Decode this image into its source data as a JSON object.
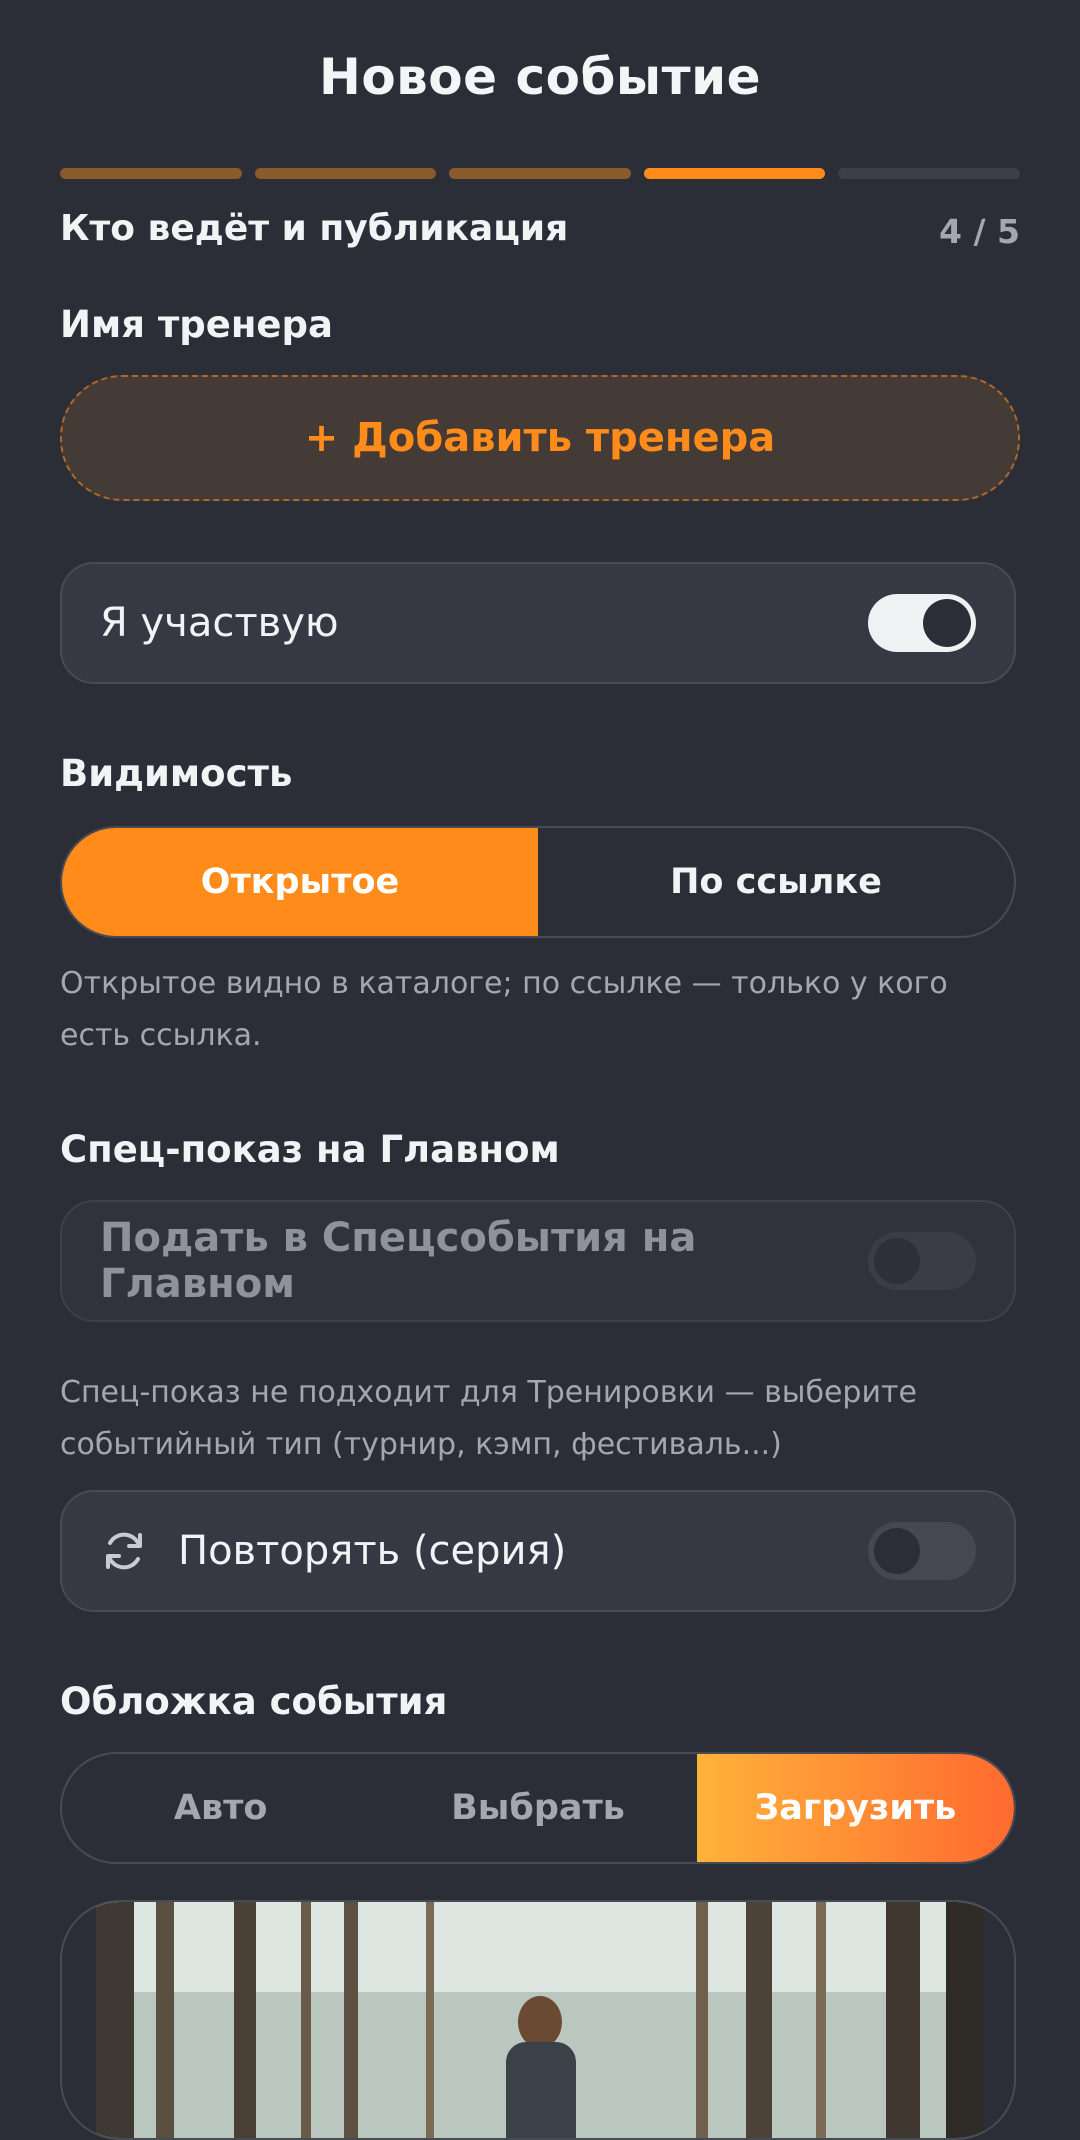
{
  "header": {
    "title": "Новое событие"
  },
  "progress": {
    "steps_total": 5,
    "current_step": 4
  },
  "step": {
    "title": "Кто ведёт и публикация",
    "counter": "4 / 5"
  },
  "coach": {
    "label": "Имя тренера",
    "add_button": "+ Добавить тренера"
  },
  "participate": {
    "label": "Я участвую",
    "enabled": true
  },
  "visibility": {
    "label": "Видимость",
    "options": [
      "Открытое",
      "По ссылке"
    ],
    "selected": "Открытое",
    "hint": "Открытое видно в каталоге; по ссылке — только у кого есть ссылка."
  },
  "special": {
    "label": "Спец-показ на Главном",
    "toggle_label": "Подать в Спецсобытия на Главном",
    "enabled": false,
    "disabled": true,
    "hint": "Спец-показ не подходит для Тренировки — выберите событийный тип (турнир, кэмп, фестиваль...)"
  },
  "repeat": {
    "label": "Повторять (серия)",
    "enabled": false,
    "icon": "refresh-icon"
  },
  "cover": {
    "label": "Обложка события",
    "options": [
      "Авто",
      "Выбрать",
      "Загрузить"
    ],
    "selected": "Загрузить"
  },
  "colors": {
    "accent": "#ff8c1a",
    "background": "#2b2e36",
    "card": "#363944"
  }
}
